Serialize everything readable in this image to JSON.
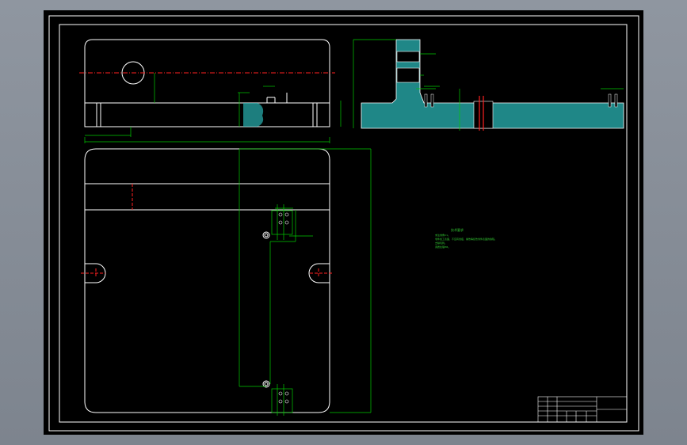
{
  "colors": {
    "background": "#8a919b",
    "sheet": "#000000",
    "border": "#ffffff",
    "dimension": "#00cc00",
    "centerline": "#ff2020",
    "hatch": "#2ab4b4",
    "outline": "#ffffff"
  },
  "technical_notes": {
    "title": "技术要求",
    "lines": [
      "未注倒角C1。",
      "零件加工表面，不应有划痕、擦伤等损伤零件表面的缺陷。",
      "去除毛刺。",
      "调质处理HB。"
    ]
  },
  "title_block": {
    "drawing_name": "",
    "material": ""
  }
}
